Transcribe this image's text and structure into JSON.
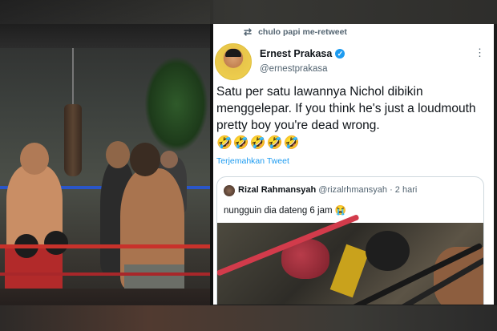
{
  "retweet": {
    "label": "chulo papi me-retweet",
    "icon": "retweet-icon"
  },
  "author": {
    "name": "Ernest Prakasa",
    "handle": "@ernestprakasa",
    "verified": true
  },
  "tweet": {
    "text": "Satu per satu lawannya Nichol dibikin menggelepar. If you think he's just a loudmouth pretty boy you're dead wrong.",
    "emojis": "🤣🤣🤣🤣🤣",
    "translate_label": "Terjemahkan Tweet"
  },
  "quote": {
    "name": "Rizal Rahmansyah",
    "handle": "@rizalrhmansyah",
    "time": "· 2 hari",
    "text": "nungguin dia dateng 6 jam 😭"
  },
  "colors": {
    "link": "#1d9bf0",
    "muted": "#536471",
    "text": "#0f1419"
  },
  "icons": {
    "more": "more-options-icon",
    "verified": "verified-badge-icon"
  }
}
